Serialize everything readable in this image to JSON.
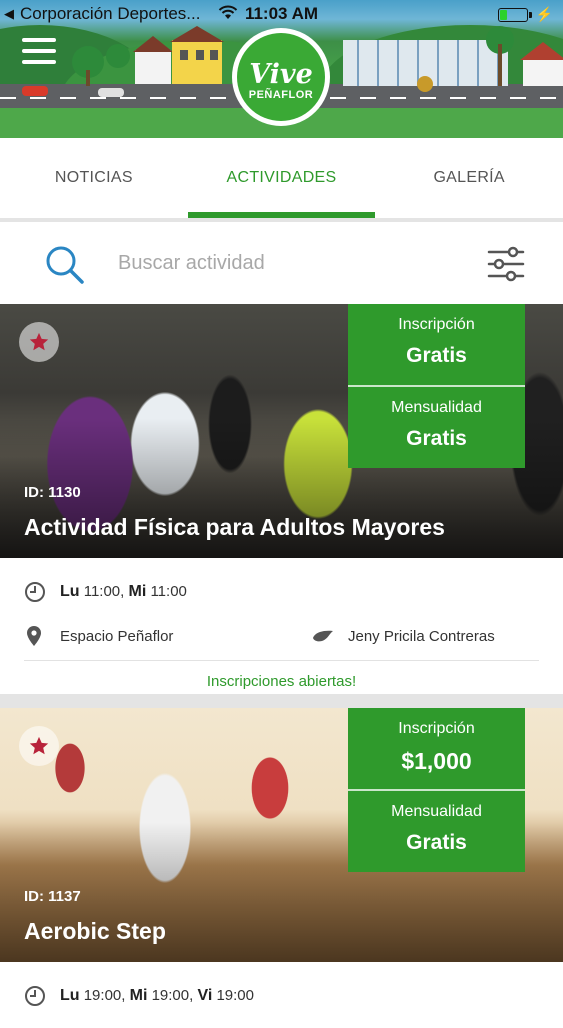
{
  "statusbar": {
    "carrier": "Corporación Deportes...",
    "time": "11:03 AM"
  },
  "header": {
    "logo_main": "Vive",
    "logo_sub": "PEÑAFLOR"
  },
  "tabs": [
    {
      "label": "NOTICIAS",
      "active": false
    },
    {
      "label": "ACTIVIDADES",
      "active": true
    },
    {
      "label": "GALERÍA",
      "active": false
    }
  ],
  "search": {
    "placeholder": "Buscar actividad"
  },
  "colors": {
    "brand_green": "#2f9a2c",
    "accent_blue": "#2a86c3"
  },
  "activities": [
    {
      "id_label": "ID: 1130",
      "title": "Actividad Física para Adultos Mayores",
      "inscription_label": "Inscripción",
      "inscription_value": "Gratis",
      "monthly_label": "Mensualidad",
      "monthly_value": "Gratis",
      "schedule": [
        {
          "day": "Lu",
          "time": "11:00"
        },
        {
          "day": "Mi",
          "time": "11:00"
        }
      ],
      "schedule_sep": ",",
      "location": "Espacio Peñaflor",
      "instructor": "Jeny Pricila Contreras",
      "status": "Inscripciones abiertas!"
    },
    {
      "id_label": "ID: 1137",
      "title": "Aerobic Step",
      "inscription_label": "Inscripción",
      "inscription_value": "$1,000",
      "monthly_label": "Mensualidad",
      "monthly_value": "Gratis",
      "schedule": [
        {
          "day": "Lu",
          "time": "19:00"
        },
        {
          "day": "Mi",
          "time": "19:00"
        },
        {
          "day": "Vi",
          "time": "19:00"
        }
      ],
      "schedule_sep": ","
    }
  ]
}
